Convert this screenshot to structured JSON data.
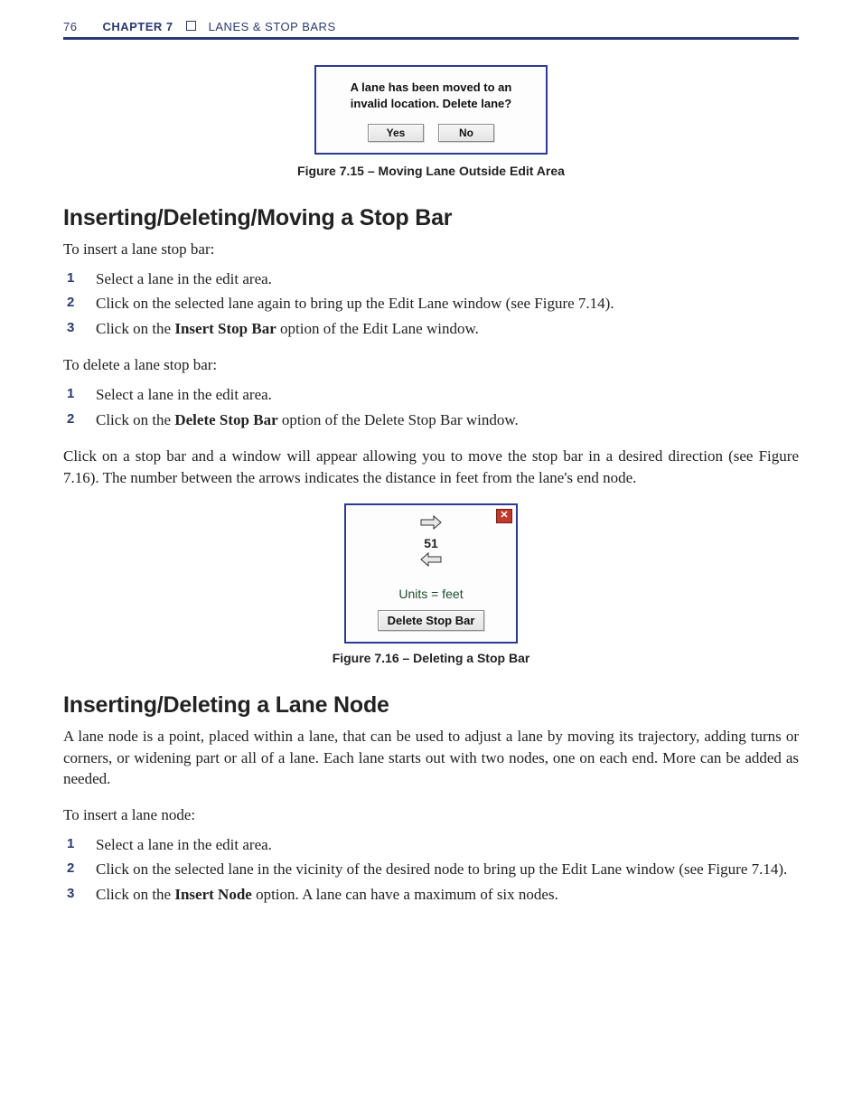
{
  "header": {
    "page_number": "76",
    "chapter_label": "CHAPTER 7",
    "chapter_title": "LANES & STOP BARS"
  },
  "dialog_move_lane": {
    "line1": "A lane has been moved to an",
    "line2": "invalid location. Delete lane?",
    "yes": "Yes",
    "no": "No"
  },
  "figure_715_caption": "Figure 7.15 – Moving Lane Outside Edit Area",
  "section1_heading": "Inserting/Deleting/Moving a Stop Bar",
  "section1_intro": "To insert a lane stop bar:",
  "s1_list1": {
    "i1": "Select a lane in the edit area.",
    "i2": "Click on the selected lane again to bring up the Edit Lane window (see Figure 7.14).",
    "i3_pre": "Click on the ",
    "i3_bold": "Insert Stop Bar",
    "i3_post": " option of the Edit Lane window."
  },
  "section1_intro2": "To delete a lane stop bar:",
  "s1_list2": {
    "i1": "Select a lane in the edit area.",
    "i2_pre": "Click on the ",
    "i2_bold": "Delete Stop Bar",
    "i2_post": " option of the Delete Stop Bar window."
  },
  "section1_para": "Click on a stop bar and a window will appear allowing you to move the stop bar in a desired direction (see Figure 7.16). The number between the arrows indicates the distance in feet from the lane's end node.",
  "dialog_stopbar": {
    "distance": "51",
    "units": "Units = feet",
    "delete_btn": "Delete Stop Bar",
    "close": "✕"
  },
  "figure_716_caption": "Figure 7.16 – Deleting a Stop Bar",
  "section2_heading": "Inserting/Deleting a Lane Node",
  "section2_para": "A lane node is a point, placed within a lane, that can be used to adjust a lane by moving its trajectory, adding turns or corners, or widening part or all of a lane. Each lane starts out with two nodes, one on each end. More can be added as needed.",
  "section2_intro": "To insert a lane node:",
  "s2_list": {
    "i1": "Select a lane in the edit area.",
    "i2": "Click on the selected lane in the vicinity of the desired node to bring up the Edit Lane window (see Figure 7.14).",
    "i3_pre": "Click on the ",
    "i3_bold": "Insert Node",
    "i3_post": " option. A lane can have a maximum of six nodes."
  }
}
